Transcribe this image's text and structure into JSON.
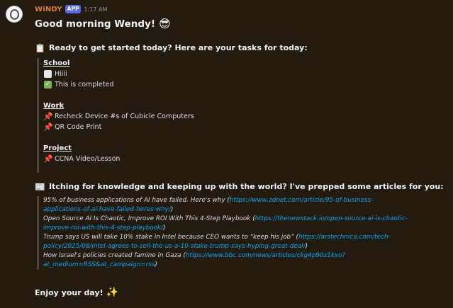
{
  "message": {
    "author": "WiNDY",
    "badge": "APP",
    "time": "1:17 AM",
    "greeting": "Good morning Wendy!",
    "greeting_emoji": "😎",
    "tasks_heading": "Ready to get started today? Here are your tasks for today:",
    "tasks_emoji": "📋",
    "categories": [
      {
        "name": "School",
        "items": [
          {
            "icon": "empty-checkbox",
            "text": "Hiiii"
          },
          {
            "icon": "check-mark",
            "text": "This is completed"
          }
        ]
      },
      {
        "name": "Work",
        "items": [
          {
            "icon": "pushpin",
            "text": "Recheck Device #s of Cubicle Computers"
          },
          {
            "icon": "pushpin",
            "text": "QR Code Print"
          }
        ]
      },
      {
        "name": "Project",
        "items": [
          {
            "icon": "pushpin",
            "text": "CCNA Video/Lesson"
          }
        ]
      }
    ],
    "articles_heading": "Itching for knowledge and keeping up with the world? I've prepped some articles for you:",
    "articles_emoji": "📰",
    "articles": [
      {
        "title": "95% of business applications of AI have failed. Here's why",
        "url": "https://www.zdnet.com/article/95-of-business-applications-of-ai-have-failed-heres-why/"
      },
      {
        "title": "Open Source AI Is Chaotic, Improve ROI With This 4-Step Playbook",
        "url": "https://thenewstack.io/open-source-ai-is-chaotic-improve-roi-with-this-4-step-playbook/"
      },
      {
        "title": "Trump says US will take 10% stake in Intel because CEO wants to “keep his job”",
        "url": "https://arstechnica.com/tech-policy/2025/08/intel-agrees-to-sell-the-us-a-10-stake-trump-says-hyping-great-deal/"
      },
      {
        "title": "How Israel's policies created famine in Gaza",
        "url": "https://www.bbc.com/news/articles/ckg4p90z1kxo?at_medium=RSS&at_campaign=rss"
      }
    ],
    "closing": "Enjoy your day!",
    "closing_emoji": "✨"
  },
  "colors": {
    "background": "#231a10",
    "author": "#e07d31",
    "badge": "#5865f2",
    "link": "#00a8fc"
  }
}
